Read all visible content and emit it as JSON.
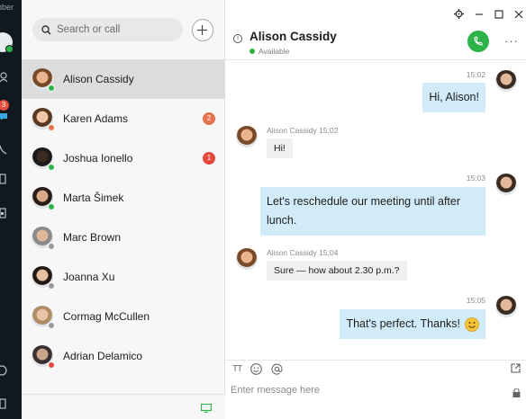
{
  "app": {
    "name": "abber"
  },
  "rail": {
    "notification_count": "3"
  },
  "search": {
    "placeholder": "Search or call"
  },
  "contacts": [
    {
      "name": "Alison Cassidy",
      "status_color": "#2cb34a",
      "unread": "",
      "skin": "#e9b48e",
      "hair": "#7a4a28"
    },
    {
      "name": "Karen Adams",
      "status_color": "#e8734f",
      "unread": "2",
      "skin": "#f1c6a6",
      "hair": "#5b3820"
    },
    {
      "name": "Joshua Ionello",
      "status_color": "#2cb34a",
      "unread": "1",
      "skin": "#3b2a22",
      "hair": "#1a1a1a"
    },
    {
      "name": "Marta Šimek",
      "status_color": "#2cb34a",
      "unread": "",
      "skin": "#d9a98a",
      "hair": "#2a1c16"
    },
    {
      "name": "Marc Brown",
      "status_color": "#9a9a9a",
      "unread": "",
      "skin": "#e0b79a",
      "hair": "#8a8a8a"
    },
    {
      "name": "Joanna Xu",
      "status_color": "#9a9a9a",
      "unread": "",
      "skin": "#e6c0a0",
      "hair": "#241a14"
    },
    {
      "name": "Cormag McCullen",
      "status_color": "#9a9a9a",
      "unread": "",
      "skin": "#e8c3a6",
      "hair": "#b08c62"
    },
    {
      "name": "Adrian Delamico",
      "status_color": "#e6493c",
      "unread": "",
      "skin": "#caa58a",
      "hair": "#3a3030"
    }
  ],
  "chat": {
    "title": "Alison Cassidy",
    "status": "Available",
    "accent": "#2cb34a",
    "messages": [
      {
        "dir": "out",
        "time": "15:02",
        "text": "Hi, Alison!"
      },
      {
        "dir": "in",
        "sender_time": "Alison Cassidy 15:02",
        "text": "Hi!"
      },
      {
        "dir": "out",
        "time": "15:03",
        "text": "Let's reschedule our meeting until after lunch."
      },
      {
        "dir": "in",
        "sender_time": "Alison Cassidy 15:04",
        "text": "Sure — how about 2.30 p.m.?"
      },
      {
        "dir": "out",
        "time": "15:05",
        "text": "That's perfect. Thanks!"
      }
    ]
  },
  "composer": {
    "placeholder": "Enter message here",
    "format_label": "TT"
  }
}
